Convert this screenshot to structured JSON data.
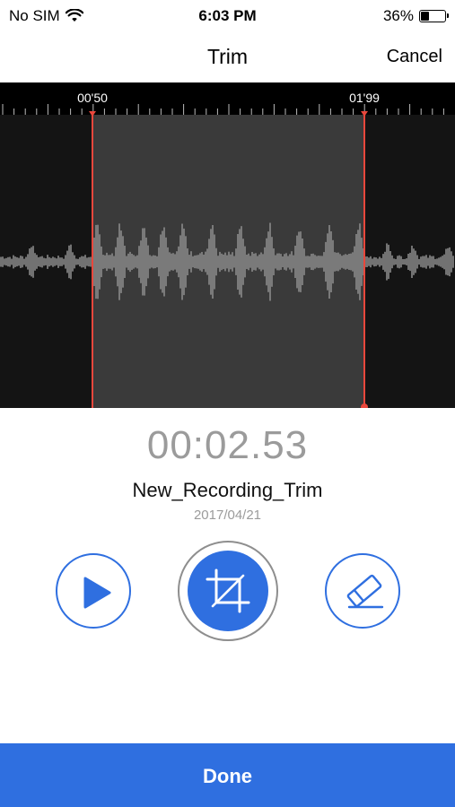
{
  "status_bar": {
    "carrier": "No SIM",
    "time": "6:03 PM",
    "battery_percent": "36%",
    "battery_level": 0.36,
    "icons": [
      "wifi-icon",
      "battery-icon"
    ]
  },
  "nav": {
    "title": "Trim",
    "cancel_label": "Cancel"
  },
  "timeline": {
    "start_marker": "00'50",
    "end_marker": "01'99"
  },
  "recording": {
    "elapsed": "00:02.53",
    "name": "New_Recording_Trim",
    "date": "2017/04/21"
  },
  "controls": {
    "play_icon": "play-icon",
    "trim_icon": "crop-icon",
    "erase_icon": "eraser-icon"
  },
  "footer": {
    "done_label": "Done"
  },
  "colors": {
    "accent": "#2f6fe0",
    "trim_handle": "#e8473c",
    "waveform_bg": "#141414",
    "selection_bg": "#3a3a3a",
    "waveform": "#8a8a8a"
  }
}
